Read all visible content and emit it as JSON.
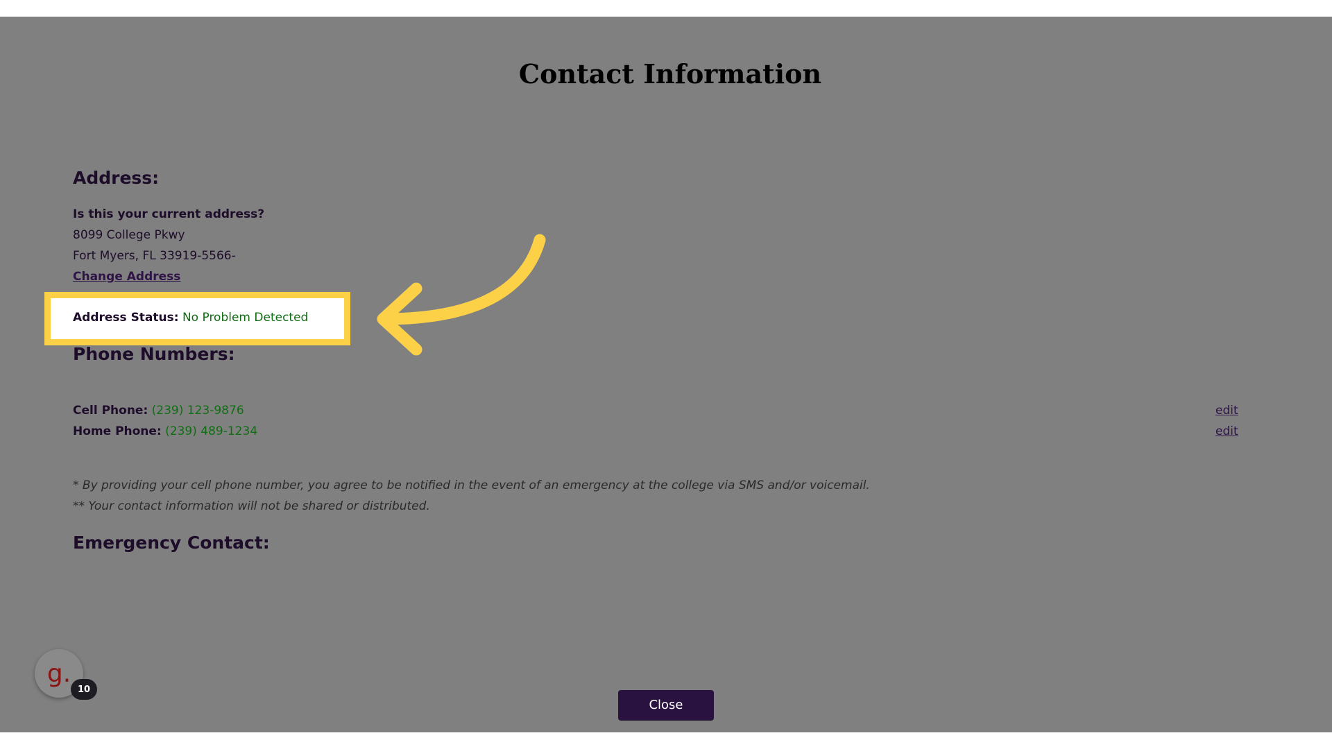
{
  "page": {
    "title": "Contact Information"
  },
  "address": {
    "heading": "Address:",
    "question": "Is this your current address?",
    "line1": "8099 College Pkwy",
    "line2": "Fort Myers, FL 33919-5566-",
    "change_link": "Change Address",
    "status_label": "Address Status:",
    "status_value": "No Problem Detected"
  },
  "phones": {
    "heading": "Phone Numbers:",
    "items": [
      {
        "label": "Cell Phone",
        "value": "(239) 123-9876",
        "edit": "edit"
      },
      {
        "label": "Home Phone",
        "value": "(239) 489-1234",
        "edit": "edit"
      }
    ]
  },
  "notes": {
    "line1": "* By providing your cell phone number, you agree to be notified in the event of an emergency at the college via SMS and/or voicemail.",
    "line2": "** Your contact information will not be shared or distributed."
  },
  "emergency": {
    "heading": "Emergency Contact:"
  },
  "widget": {
    "logo_text": "g.",
    "count": "10"
  },
  "footer": {
    "close_label": "Close"
  },
  "colors": {
    "highlight": "#fcd148",
    "status_green": "#0f6e12",
    "button": "#2a1240",
    "overlay": "#808080"
  },
  "icons": {
    "annotation": "curved-arrow-icon"
  }
}
